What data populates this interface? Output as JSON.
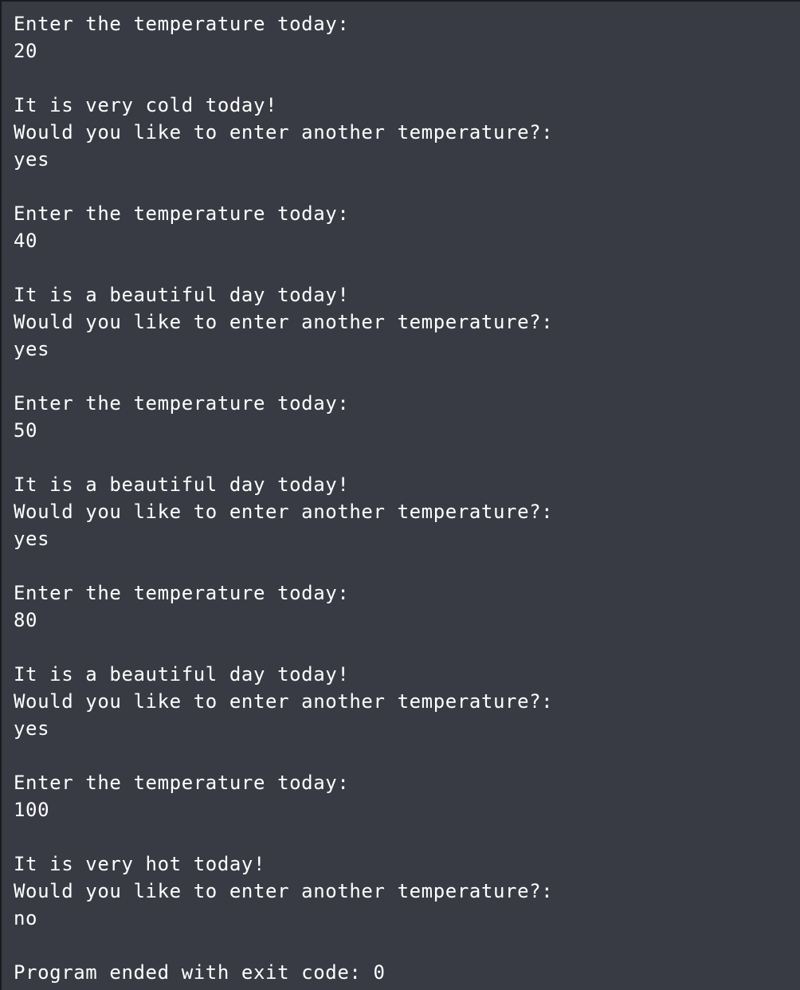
{
  "console": {
    "lines": [
      "Enter the temperature today:",
      "20",
      "",
      "It is very cold today!",
      "Would you like to enter another temperature?:",
      "yes",
      "",
      "Enter the temperature today:",
      "40",
      "",
      "It is a beautiful day today!",
      "Would you like to enter another temperature?:",
      "yes",
      "",
      "Enter the temperature today:",
      "50",
      "",
      "It is a beautiful day today!",
      "Would you like to enter another temperature?:",
      "yes",
      "",
      "Enter the temperature today:",
      "80",
      "",
      "It is a beautiful day today!",
      "Would you like to enter another temperature?:",
      "yes",
      "",
      "Enter the temperature today:",
      "100",
      "",
      "It is very hot today!",
      "Would you like to enter another temperature?:",
      "no",
      "",
      "Program ended with exit code: 0"
    ]
  }
}
